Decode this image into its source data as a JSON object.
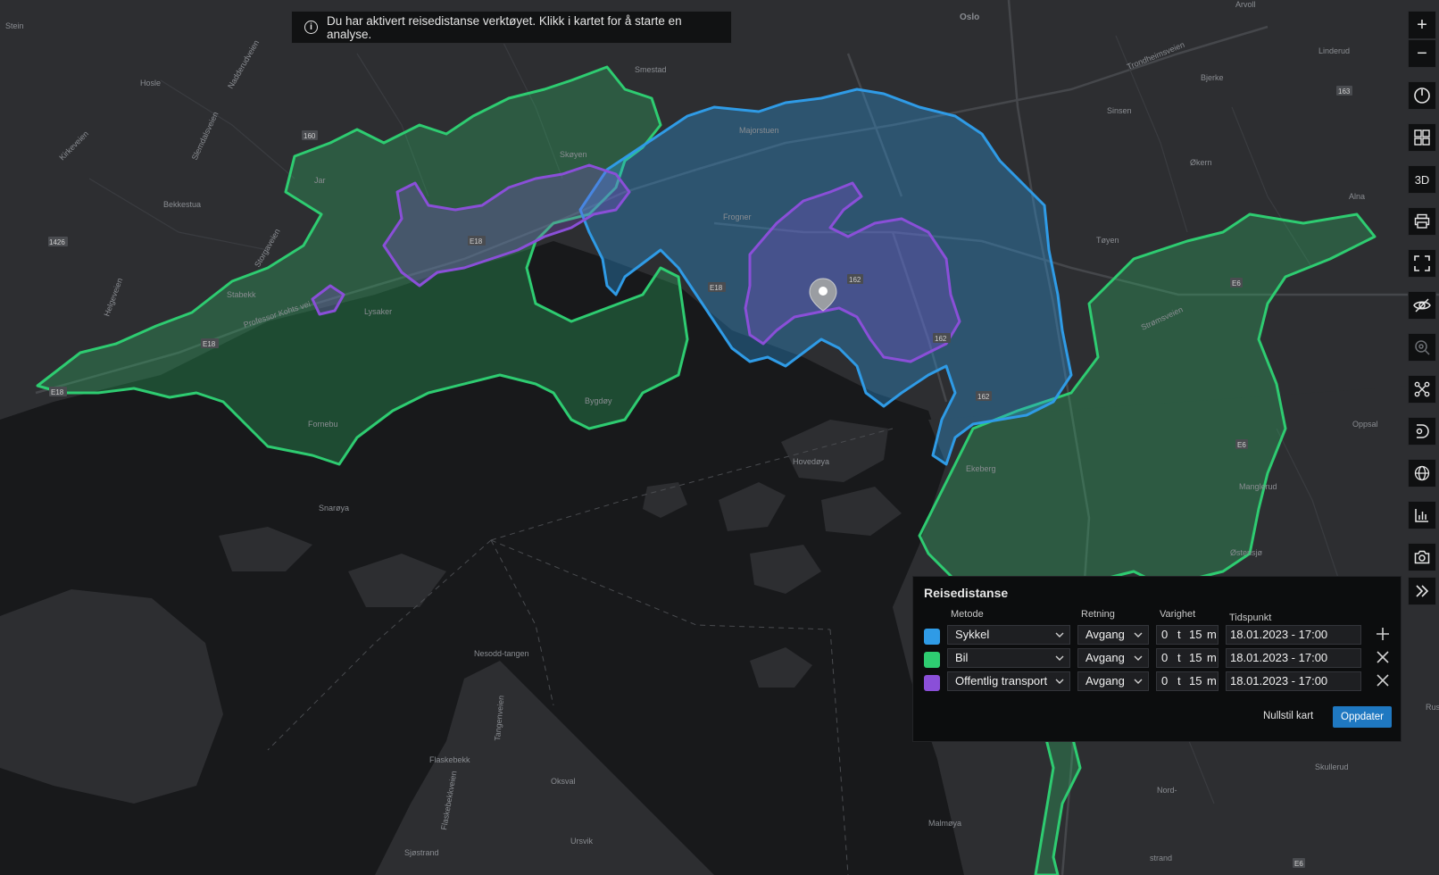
{
  "banner": {
    "icon": "info-icon",
    "text": "Du har aktivert reisedistanse verktøyet. Klikk i kartet for å starte en analyse."
  },
  "map": {
    "background_land": "#2d2e31",
    "background_water": "#18191b",
    "place_labels": [
      "Stein",
      "Hosle",
      "Jar",
      "Bekkestua",
      "Stabekk",
      "Lysaker",
      "Professor Kohts vei",
      "Smestad",
      "Skøyen",
      "Majorstuen",
      "Frogner",
      "Oslo",
      "Sinsen",
      "Bjerke",
      "Linderud",
      "Arvoll",
      "Økern",
      "Tøyen",
      "Alna",
      "Strømsveien",
      "Trondheimsveien",
      "Oppsal",
      "Manglerud",
      "Ekeberg",
      "Hovedøya",
      "Snarøya",
      "Fornebu",
      "Bygdøy",
      "Østensjø",
      "Nesodd-tangen",
      "Oksval",
      "Flaskebekk",
      "Ursvik",
      "Sjøstrand",
      "Malmøya",
      "Nord-",
      "Skullerud",
      "Rus",
      "Kirkeveien",
      "Nadderudveien",
      "Storgaveien",
      "Tangenveien",
      "Flaskebekkveien",
      "Helgeveien",
      "strand",
      "Slemdalsveien"
    ],
    "road_shields": [
      "160",
      "168",
      "E18",
      "E18",
      "E18",
      "E18",
      "162",
      "162",
      "162",
      "E6",
      "E6",
      "E6",
      "163",
      "1426"
    ],
    "isochrones": [
      {
        "method": "Sykkel",
        "color": "#2f9be6"
      },
      {
        "method": "Bil",
        "color": "#2ecc71"
      },
      {
        "method": "Offentlig transport",
        "color": "#8a4fd8"
      }
    ],
    "marker_icon": "location-pin-icon"
  },
  "toolbar": [
    {
      "name": "zoom-in-button",
      "icon": "plus-icon",
      "label": "+"
    },
    {
      "name": "zoom-out-button",
      "icon": "minus-icon",
      "label": "−"
    },
    {
      "name": "compass-button",
      "icon": "compass-icon"
    },
    {
      "name": "basemap-button",
      "icon": "grid-map-icon"
    },
    {
      "name": "3d-button",
      "icon": "3d-icon",
      "label": "3D"
    },
    {
      "name": "print-button",
      "icon": "printer-icon"
    },
    {
      "name": "fullscreen-button",
      "icon": "fullscreen-icon"
    },
    {
      "name": "visibility-button",
      "icon": "eye-off-icon"
    },
    {
      "name": "search-location-button",
      "icon": "search-location-icon"
    },
    {
      "name": "route-button",
      "icon": "route-icon"
    },
    {
      "name": "distance-button",
      "icon": "distance-icon"
    },
    {
      "name": "globe-button",
      "icon": "globe-icon"
    },
    {
      "name": "statistics-button",
      "icon": "bar-chart-icon"
    },
    {
      "name": "camera-button",
      "icon": "camera-icon"
    }
  ],
  "panel": {
    "title": "Reisedistanse",
    "headers": {
      "method": "Metode",
      "direction": "Retning",
      "duration": "Varighet",
      "time": "Tidspunkt"
    },
    "rows": [
      {
        "color": "#2f9be6",
        "method": "Sykkel",
        "direction": "Avgang",
        "hours": "0",
        "hours_unit": "t",
        "minutes": "15",
        "minutes_unit": "m",
        "time": "18.01.2023 - 17:00",
        "action_icon": "plus-icon"
      },
      {
        "color": "#2ecc71",
        "method": "Bil",
        "direction": "Avgang",
        "hours": "0",
        "hours_unit": "t",
        "minutes": "15",
        "minutes_unit": "m",
        "time": "18.01.2023 - 17:00",
        "action_icon": "close-icon"
      },
      {
        "color": "#8a4fd8",
        "method": "Offentlig transport",
        "direction": "Avgang",
        "hours": "0",
        "hours_unit": "t",
        "minutes": "15",
        "minutes_unit": "m",
        "time": "18.01.2023 - 17:00",
        "action_icon": "close-icon"
      }
    ],
    "reset_label": "Nullstil kart",
    "update_label": "Oppdater",
    "update_color": "#1f78c1",
    "collapse_icon": "double-chevron-right-icon"
  }
}
